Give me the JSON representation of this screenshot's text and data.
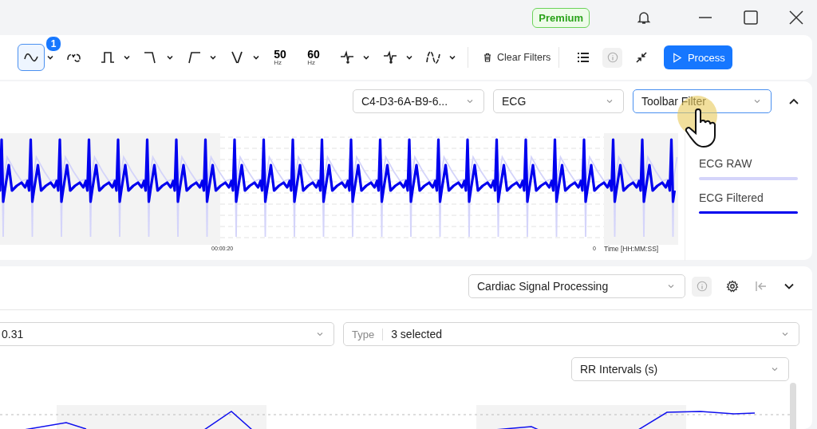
{
  "title_bar": {
    "badge": "Premium"
  },
  "toolbar": {
    "tools": [
      {
        "kind": "sine",
        "badge": "1",
        "selected": true,
        "dropdown": true
      },
      {
        "kind": "loop",
        "selected": false,
        "dropdown": false
      },
      {
        "kind": "bandpass",
        "selected": false,
        "dropdown": true
      },
      {
        "kind": "lowpass",
        "selected": false,
        "dropdown": true
      },
      {
        "kind": "highpass",
        "selected": false,
        "dropdown": true
      },
      {
        "kind": "notch",
        "selected": false,
        "dropdown": true
      },
      {
        "kind": "hz",
        "label": "50",
        "unit": "Hz",
        "selected": false,
        "dropdown": false
      },
      {
        "kind": "hz",
        "label": "60",
        "unit": "Hz",
        "selected": false,
        "dropdown": false
      },
      {
        "kind": "peak",
        "selected": false,
        "dropdown": true
      },
      {
        "kind": "valley",
        "selected": false,
        "dropdown": true
      },
      {
        "kind": "wave",
        "selected": false,
        "dropdown": true
      }
    ],
    "clear_label": "Clear Filters",
    "process_label": "Process"
  },
  "signal_panel": {
    "selects": [
      {
        "value": "C4-D3-6A-B9-6...",
        "focused": false
      },
      {
        "value": "ECG",
        "focused": false
      },
      {
        "value": "Toolbar Filter",
        "focused": true
      }
    ],
    "chart": {
      "x_tick": "00:00:20",
      "end_tick": "0",
      "x_label": "Time [HH:MM:SS]"
    },
    "legend": [
      {
        "label": "ECG RAW",
        "color": "#d4d4fa"
      },
      {
        "label": "ECG Filtered",
        "color": "#0000ee"
      }
    ]
  },
  "analysis_panel": {
    "pipeline": "Cardiac Signal Processing",
    "filters": [
      {
        "value": "0.31"
      },
      {
        "label": "Type",
        "value": "3 selected"
      }
    ],
    "metric": "RR Intervals (s)"
  }
}
